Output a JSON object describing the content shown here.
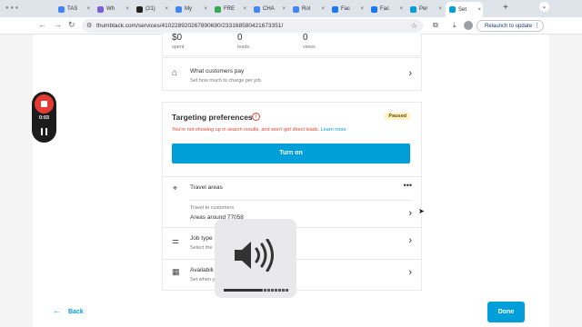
{
  "browser": {
    "tabs": [
      {
        "label": "TAS",
        "color": "#4285f4"
      },
      {
        "label": "Wh",
        "color": "#7b5fd6"
      },
      {
        "label": "(21)",
        "color": "#222222"
      },
      {
        "label": "My",
        "color": "#4285f4"
      },
      {
        "label": "FRE",
        "color": "#34a853"
      },
      {
        "label": "CHA",
        "color": "#4285f4"
      },
      {
        "label": "Rol",
        "color": "#4285f4"
      },
      {
        "label": "Fac",
        "color": "#1877f2"
      },
      {
        "label": "Fac",
        "color": "#1877f2"
      },
      {
        "label": "Per",
        "color": "#009fd9"
      },
      {
        "label": "Set",
        "color": "#009fd9"
      }
    ],
    "url": "thumbtack.com/services/410228920267890690/233168580421673351/",
    "relaunch_label": "Relaunch to update"
  },
  "stats": {
    "spent_value": "$0",
    "spent_label": "spent",
    "leads_value": "0",
    "leads_label": "leads",
    "views_value": "0",
    "views_label": "views"
  },
  "customers_pay": {
    "title": "What customers pay",
    "subtitle": "Set how much to charge per job."
  },
  "targeting": {
    "title": "Targeting preferences",
    "badge": "Paused",
    "notice": "You're not showing up in search results, and won't get direct leads.",
    "learn_more": "Learn more",
    "turn_on_label": "Turn on",
    "travel_areas": {
      "title": "Travel areas",
      "sub_label": "Travel to customers",
      "value": "Areas around 77058"
    },
    "job_types": {
      "title": "Job type",
      "subtitle": "Select the"
    },
    "availability": {
      "title": "Availabili",
      "subtitle": "Set when y"
    }
  },
  "recorder": {
    "time": "0:03"
  },
  "volume_level": 0.58,
  "footer": {
    "back_label": "Back",
    "done_label": "Done"
  }
}
